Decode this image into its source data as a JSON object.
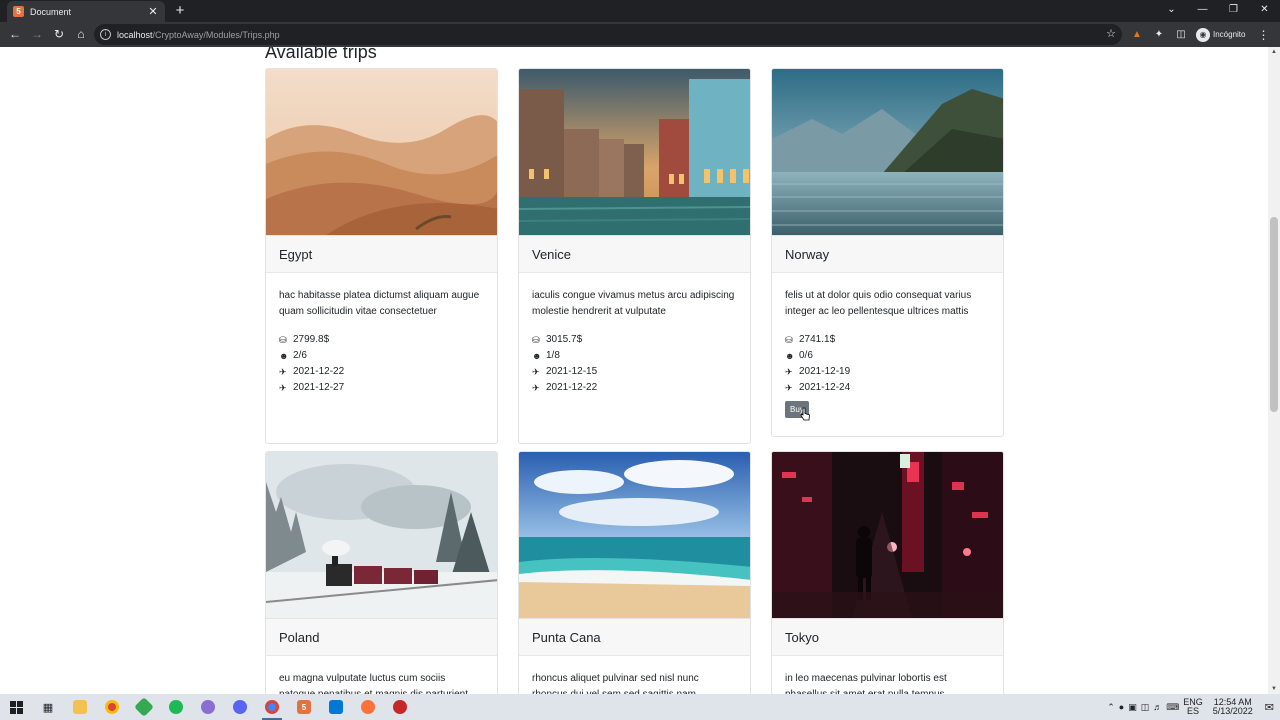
{
  "browser": {
    "tab_title": "Document",
    "tab_close": "✕",
    "new_tab": "+",
    "url_host": "localhost",
    "url_path": "/CryptoAway/Modules/Trips.php",
    "profile_label": "Incógnito",
    "window_controls": [
      "⌄",
      "—",
      "❐",
      "✕"
    ]
  },
  "page": {
    "title": "Available trips",
    "buy_label": "Buy"
  },
  "trips": [
    {
      "name": "Egypt",
      "description": "hac habitasse platea dictumst aliquam augue quam sollicitudin vitae consectetuer",
      "price": "2799.8$",
      "seats": "2/6",
      "departure": "2021-12-22",
      "arrival": "2021-12-27"
    },
    {
      "name": "Venice",
      "description": "iaculis congue vivamus metus arcu adipiscing molestie hendrerit at vulputate",
      "price": "3015.7$",
      "seats": "1/8",
      "departure": "2021-12-15",
      "arrival": "2021-12-22"
    },
    {
      "name": "Norway",
      "description": "felis ut at dolor quis odio consequat varius integer ac leo pellentesque ultrices mattis",
      "price": "2741.1$",
      "seats": "0/6",
      "departure": "2021-12-19",
      "arrival": "2021-12-24"
    },
    {
      "name": "Poland",
      "description": "eu magna vulputate luctus cum sociis natoque penatibus et magnis dis parturient"
    },
    {
      "name": "Punta Cana",
      "description": "rhoncus aliquet pulvinar sed nisl nunc rhoncus dui vel sem sed sagittis nam"
    },
    {
      "name": "Tokyo",
      "description": "in leo maecenas pulvinar lobortis est phasellus sit amet erat nulla tempus"
    }
  ],
  "taskbar": {
    "lang_top": "ENG",
    "lang_bottom": "ES",
    "time": "12:54 AM",
    "date": "5/13/2022"
  }
}
